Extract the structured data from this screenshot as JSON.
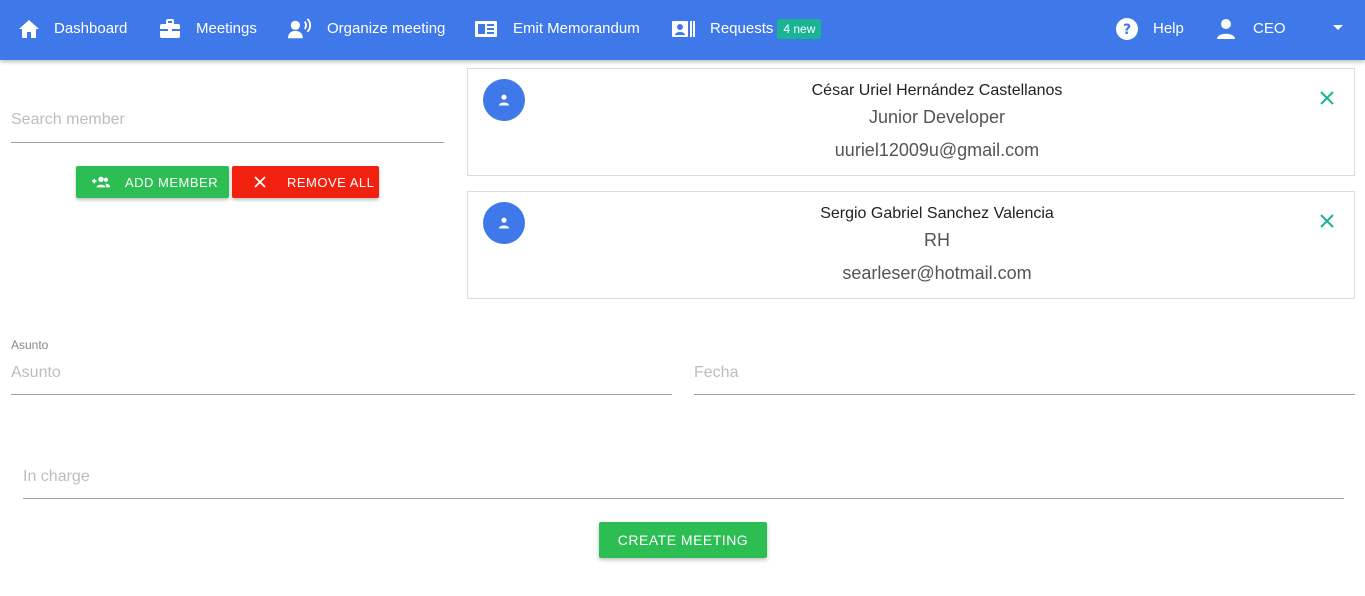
{
  "nav": {
    "items": [
      {
        "label": "Dashboard",
        "icon": "home-icon"
      },
      {
        "label": "Meetings",
        "icon": "briefcase-icon"
      },
      {
        "label": "Organize meeting",
        "icon": "voice-person-icon"
      },
      {
        "label": "Emit Memorandum",
        "icon": "memo-icon"
      },
      {
        "label": "Requests",
        "icon": "contact-card-icon",
        "badge": "4 new"
      }
    ],
    "help_label": "Help",
    "user_label": "CEO"
  },
  "members_panel": {
    "search_placeholder": "Search member",
    "add_label": "ADD MEMBER",
    "remove_all_label": "REMOVE ALL"
  },
  "members": [
    {
      "name": "César Uriel Hernández Castellanos",
      "role": "Junior Developer",
      "email": "uuriel12009u@gmail.com"
    },
    {
      "name": "Sergio Gabriel Sanchez Valencia",
      "role": "RH",
      "email": "searleser@hotmail.com"
    }
  ],
  "form": {
    "asunto_label": "Asunto",
    "asunto_placeholder": "Asunto",
    "fecha_placeholder": "Fecha",
    "in_charge_placeholder": "In charge",
    "create_label": "CREATE MEETING"
  },
  "colors": {
    "primary": "#3f78e8",
    "success": "#2cbd53",
    "danger": "#f2200f",
    "badge": "#1ab394",
    "close_icon": "#1ab394"
  }
}
